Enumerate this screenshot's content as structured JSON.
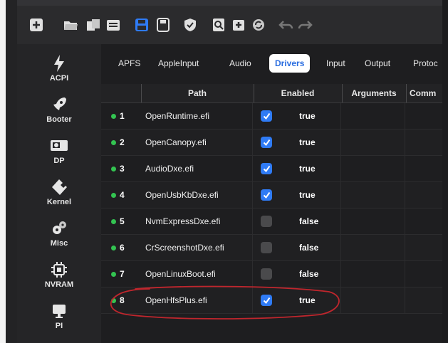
{
  "sidebar": {
    "items": [
      {
        "label": "ACPI",
        "icon": "bolt-icon"
      },
      {
        "label": "Booter",
        "icon": "rocket-icon"
      },
      {
        "label": "DP",
        "icon": "gpu-card-icon"
      },
      {
        "label": "Kernel",
        "icon": "puzzle-icon"
      },
      {
        "label": "Misc",
        "icon": "gears-icon"
      },
      {
        "label": "NVRAM",
        "icon": "chip-icon"
      },
      {
        "label": "PI",
        "icon": "monitor-icon"
      }
    ]
  },
  "tabs": [
    {
      "label": "APFS"
    },
    {
      "label": "AppleInput"
    },
    {
      "label": "Audio"
    },
    {
      "label": "Drivers"
    },
    {
      "label": "Input"
    },
    {
      "label": "Output"
    },
    {
      "label": "Protoc"
    }
  ],
  "table": {
    "columns": [
      "Path",
      "Enabled",
      "Arguments",
      "Comm"
    ],
    "rows": [
      {
        "num": "1",
        "path": "OpenRuntime.efi",
        "enabled": true,
        "enabled_text": "true"
      },
      {
        "num": "2",
        "path": "OpenCanopy.efi",
        "enabled": true,
        "enabled_text": "true"
      },
      {
        "num": "3",
        "path": "AudioDxe.efi",
        "enabled": true,
        "enabled_text": "true"
      },
      {
        "num": "4",
        "path": "OpenUsbKbDxe.efi",
        "enabled": true,
        "enabled_text": "true"
      },
      {
        "num": "5",
        "path": "NvmExpressDxe.efi",
        "enabled": false,
        "enabled_text": "false"
      },
      {
        "num": "6",
        "path": "CrScreenshotDxe.efi",
        "enabled": false,
        "enabled_text": "false"
      },
      {
        "num": "7",
        "path": "OpenLinuxBoot.efi",
        "enabled": false,
        "enabled_text": "false"
      },
      {
        "num": "8",
        "path": "OpenHfsPlus.efi",
        "enabled": true,
        "enabled_text": "true"
      }
    ]
  },
  "colors": {
    "accent": "#2f7bf5",
    "status_dot": "#33c451",
    "annotation": "#c0262d",
    "background": "#1e1e20"
  },
  "toolbar_icons": [
    "add-icon",
    "open-folder-icon",
    "copy-icon",
    "folder-icon",
    "save-icon",
    "save-as-icon",
    "shield-check-icon",
    "search-doc-icon",
    "import-icon",
    "sync-icon",
    "undo-icon",
    "redo-icon"
  ]
}
